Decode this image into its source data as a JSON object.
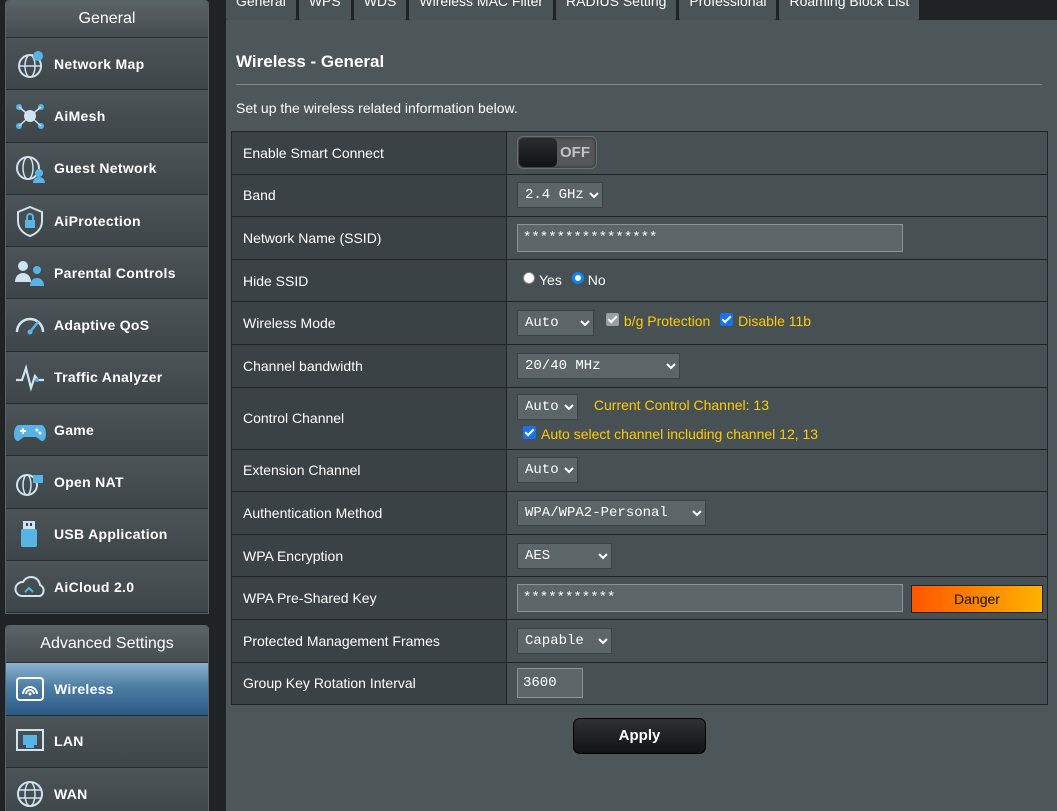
{
  "sidebar": {
    "general_header": "General",
    "general_items": [
      {
        "label": "Network Map",
        "icon": "network-map-icon"
      },
      {
        "label": "AiMesh",
        "icon": "aimesh-icon"
      },
      {
        "label": "Guest Network",
        "icon": "guest-network-icon"
      },
      {
        "label": "AiProtection",
        "icon": "aiprotection-icon"
      },
      {
        "label": "Parental Controls",
        "icon": "parental-controls-icon"
      },
      {
        "label": "Adaptive QoS",
        "icon": "adaptive-qos-icon"
      },
      {
        "label": "Traffic Analyzer",
        "icon": "traffic-analyzer-icon"
      },
      {
        "label": "Game",
        "icon": "game-icon"
      },
      {
        "label": "Open NAT",
        "icon": "open-nat-icon"
      },
      {
        "label": "USB Application",
        "icon": "usb-application-icon"
      },
      {
        "label": "AiCloud 2.0",
        "icon": "aicloud-icon"
      }
    ],
    "advanced_header": "Advanced Settings",
    "advanced_items": [
      {
        "label": "Wireless",
        "icon": "wireless-icon",
        "active": true
      },
      {
        "label": "LAN",
        "icon": "lan-icon"
      },
      {
        "label": "WAN",
        "icon": "wan-icon"
      }
    ]
  },
  "tabs": [
    "General",
    "WPS",
    "WDS",
    "Wireless MAC Filter",
    "RADIUS Setting",
    "Professional",
    "Roaming Block List"
  ],
  "page": {
    "title": "Wireless - General",
    "description": "Set up the wireless related information below."
  },
  "form": {
    "smart_connect": {
      "label": "Enable Smart Connect",
      "state": "OFF"
    },
    "band": {
      "label": "Band",
      "value": "2.4 GHz"
    },
    "ssid": {
      "label": "Network Name (SSID)",
      "value": "****************"
    },
    "hide_ssid": {
      "label": "Hide SSID",
      "yes": "Yes",
      "no": "No",
      "selected": "No"
    },
    "wireless_mode": {
      "label": "Wireless Mode",
      "value": "Auto",
      "bg_protection": "b/g Protection",
      "disable_11b": "Disable 11b"
    },
    "channel_bandwidth": {
      "label": "Channel bandwidth",
      "value": "20/40 MHz"
    },
    "control_channel": {
      "label": "Control Channel",
      "value": "Auto",
      "current": "Current Control Channel: 13",
      "auto_select": "Auto select channel including channel 12, 13"
    },
    "extension_channel": {
      "label": "Extension Channel",
      "value": "Auto"
    },
    "auth_method": {
      "label": "Authentication Method",
      "value": "WPA/WPA2-Personal"
    },
    "wpa_encryption": {
      "label": "WPA Encryption",
      "value": "AES"
    },
    "psk": {
      "label": "WPA Pre-Shared Key",
      "value": "***********",
      "strength": "Danger"
    },
    "pmf": {
      "label": "Protected Management Frames",
      "value": "Capable"
    },
    "gkri": {
      "label": "Group Key Rotation Interval",
      "value": "3600"
    }
  },
  "apply_label": "Apply"
}
